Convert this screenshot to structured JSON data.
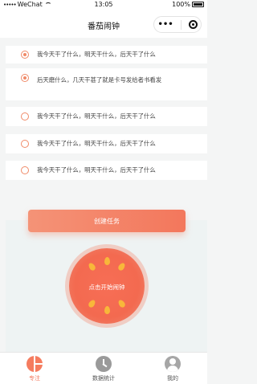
{
  "status_bar": {
    "signal": "•••••",
    "carrier": "WeChat",
    "time": "13:05",
    "battery": "100%"
  },
  "nav": {
    "title": "番茄闹钟",
    "more_icon": "more-dots-icon",
    "close_icon": "target-circle-icon"
  },
  "tasks": [
    {
      "text": "我今天干了什么，明天干什么，后天干了什么",
      "checked": true
    },
    {
      "text": "后天磨什么，几天干甚了就是卡号发给者书看发",
      "checked": true
    },
    {
      "text": "我今天干了什么，明天干什么，后天干了什么",
      "checked": false
    },
    {
      "text": "我今天干了什么，明天干什么，后天干了什么",
      "checked": false
    },
    {
      "text": "我今天干了什么，明天干什么，后天干了什么",
      "checked": false
    }
  ],
  "create_button": {
    "label": "创建任务"
  },
  "tomato": {
    "label": "点击开始闹钟"
  },
  "tabs": [
    {
      "label": "专注",
      "icon": "focus-icon",
      "active": true
    },
    {
      "label": "数据统计",
      "icon": "clock-stats-icon",
      "active": false
    },
    {
      "label": "我的",
      "icon": "user-icon",
      "active": false
    }
  ],
  "colors": {
    "accent": "#f3775c",
    "accent_light": "#f49377",
    "seed": "#f8b73a",
    "panel": "#eef3f3"
  }
}
